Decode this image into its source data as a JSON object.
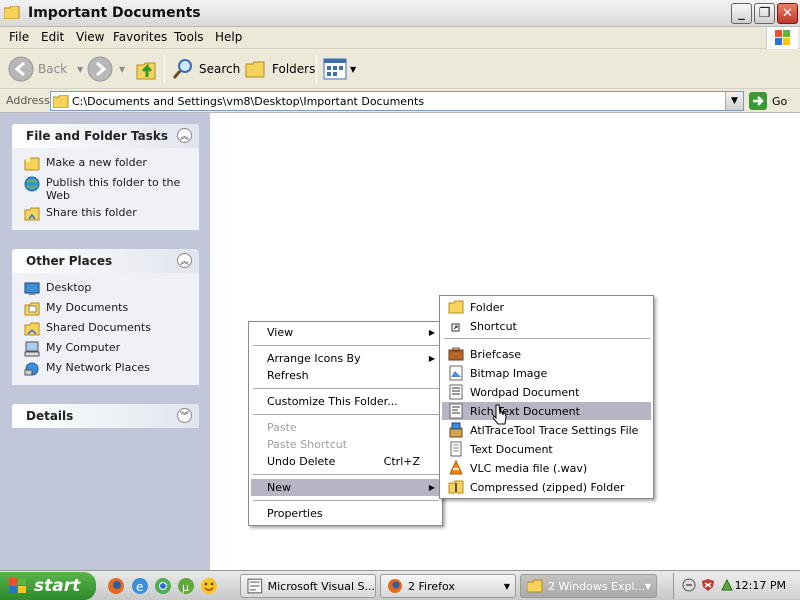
{
  "window": {
    "title": "Important Documents",
    "buttons": {
      "minimize": "_",
      "maximize": "❐",
      "close": "✕"
    }
  },
  "menubar": {
    "items": [
      "File",
      "Edit",
      "View",
      "Favorites",
      "Tools",
      "Help"
    ]
  },
  "toolbar": {
    "back": "Back",
    "search": "Search",
    "folders": "Folders"
  },
  "address": {
    "label": "Address",
    "path": "C:\\Documents and Settings\\vm8\\Desktop\\Important Documents",
    "go": "Go"
  },
  "tasks_panel": {
    "title": "File and Folder Tasks",
    "items": [
      "Make a new folder",
      "Publish this folder to the Web",
      "Share this folder"
    ]
  },
  "places_panel": {
    "title": "Other Places",
    "items": [
      "Desktop",
      "My Documents",
      "Shared Documents",
      "My Computer",
      "My Network Places"
    ]
  },
  "details_panel": {
    "title": "Details"
  },
  "context_menu": {
    "items": [
      {
        "label": "View",
        "submenu": true,
        "disabled": false
      },
      {
        "label": "Arrange Icons By",
        "submenu": true,
        "disabled": false
      },
      {
        "label": "Refresh",
        "submenu": false,
        "disabled": false
      },
      {
        "label": "Customize This Folder...",
        "submenu": false,
        "disabled": false
      },
      {
        "label": "Paste",
        "submenu": false,
        "disabled": true
      },
      {
        "label": "Paste Shortcut",
        "submenu": false,
        "disabled": true
      },
      {
        "label": "Undo Delete",
        "shortcut": "Ctrl+Z",
        "submenu": false,
        "disabled": false
      },
      {
        "label": "New",
        "submenu": true,
        "disabled": false,
        "active": true
      },
      {
        "label": "Properties",
        "submenu": false,
        "disabled": false
      }
    ]
  },
  "new_submenu": {
    "items": [
      {
        "label": "Folder",
        "icon": "folder-icon"
      },
      {
        "label": "Shortcut",
        "icon": "shortcut-icon"
      },
      {
        "label": "Briefcase",
        "icon": "briefcase-icon"
      },
      {
        "label": "Bitmap Image",
        "icon": "bitmap-icon"
      },
      {
        "label": "Wordpad Document",
        "icon": "wordpad-icon"
      },
      {
        "label": "Rich Text Document",
        "icon": "richtext-icon",
        "active": true
      },
      {
        "label": "AtlTraceTool Trace Settings File",
        "icon": "atltrace-icon"
      },
      {
        "label": "Text Document",
        "icon": "text-doc-icon"
      },
      {
        "label": "VLC media file (.wav)",
        "icon": "vlc-icon"
      },
      {
        "label": "Compressed (zipped) Folder",
        "icon": "zip-folder-icon"
      }
    ]
  },
  "taskbar": {
    "start": "start",
    "tasks": [
      {
        "label": "Microsoft Visual S..."
      },
      {
        "label": "2 Firefox",
        "count": "2"
      },
      {
        "label": "2 Windows Expl...",
        "count": "2",
        "active": true
      }
    ],
    "clock": "12:17 PM"
  },
  "colors": {
    "left_pane": "#c1c7d9",
    "menu_highlight": "#b5b5c3",
    "start_green": "#3c9b36"
  }
}
